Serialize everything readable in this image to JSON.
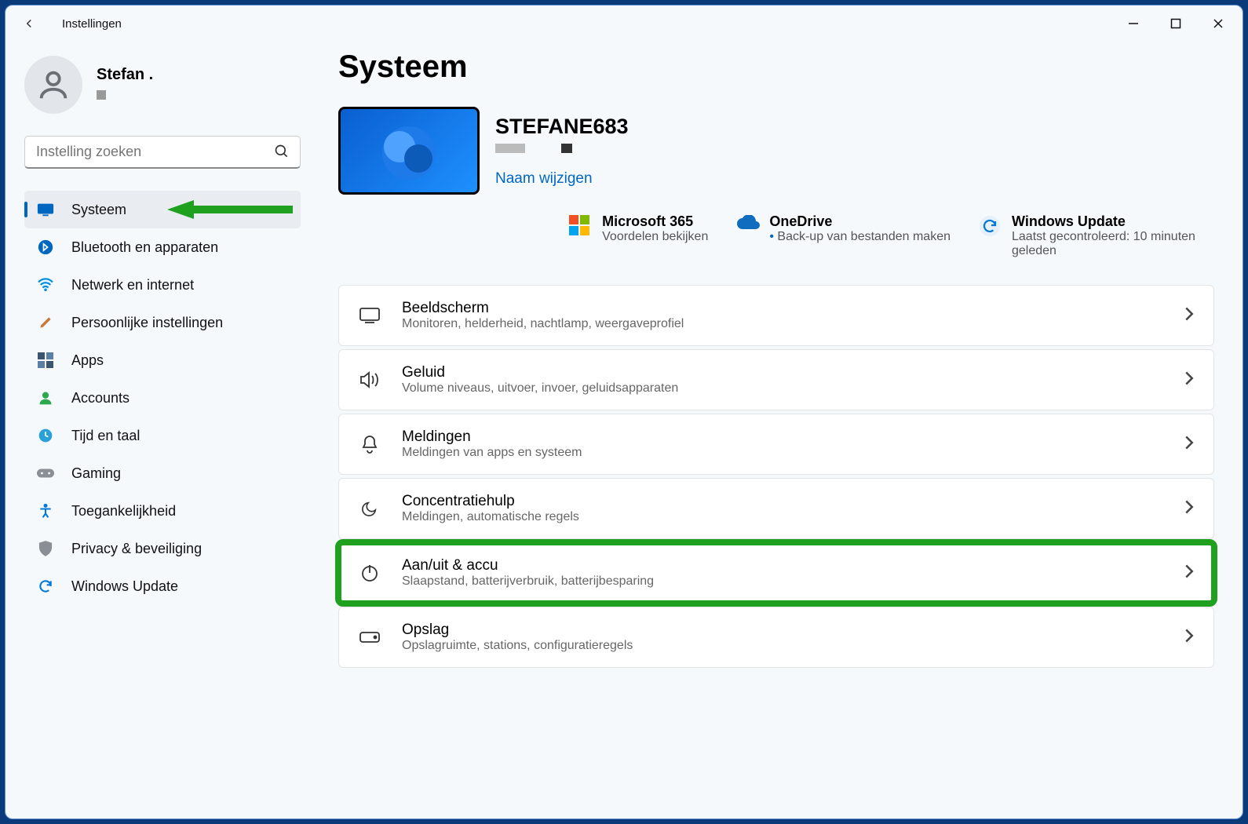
{
  "app_title": "Instellingen",
  "user": {
    "name": "Stefan ."
  },
  "search": {
    "placeholder": "Instelling zoeken"
  },
  "sidebar": {
    "items": [
      {
        "label": "Systeem"
      },
      {
        "label": "Bluetooth en apparaten"
      },
      {
        "label": "Netwerk en internet"
      },
      {
        "label": "Persoonlijke instellingen"
      },
      {
        "label": "Apps"
      },
      {
        "label": "Accounts"
      },
      {
        "label": "Tijd en taal"
      },
      {
        "label": "Gaming"
      },
      {
        "label": "Toegankelijkheid"
      },
      {
        "label": "Privacy & beveiliging"
      },
      {
        "label": "Windows Update"
      }
    ]
  },
  "page": {
    "title": "Systeem",
    "device_name": "STEFANE683",
    "rename": "Naam wijzigen"
  },
  "status": {
    "m365": {
      "title": "Microsoft 365",
      "sub": "Voordelen bekijken"
    },
    "onedrive": {
      "title": "OneDrive",
      "sub": "Back-up van bestanden maken"
    },
    "update": {
      "title": "Windows Update",
      "sub": "Laatst gecontroleerd: 10 minuten geleden"
    }
  },
  "cards": [
    {
      "title": "Beeldscherm",
      "sub": "Monitoren, helderheid, nachtlamp, weergaveprofiel"
    },
    {
      "title": "Geluid",
      "sub": "Volume niveaus, uitvoer, invoer, geluidsapparaten"
    },
    {
      "title": "Meldingen",
      "sub": "Meldingen van apps en systeem"
    },
    {
      "title": "Concentratiehulp",
      "sub": "Meldingen, automatische regels"
    },
    {
      "title": "Aan/uit & accu",
      "sub": "Slaapstand, batterijverbruik, batterijbesparing"
    },
    {
      "title": "Opslag",
      "sub": "Opslagruimte, stations, configuratieregels"
    }
  ]
}
